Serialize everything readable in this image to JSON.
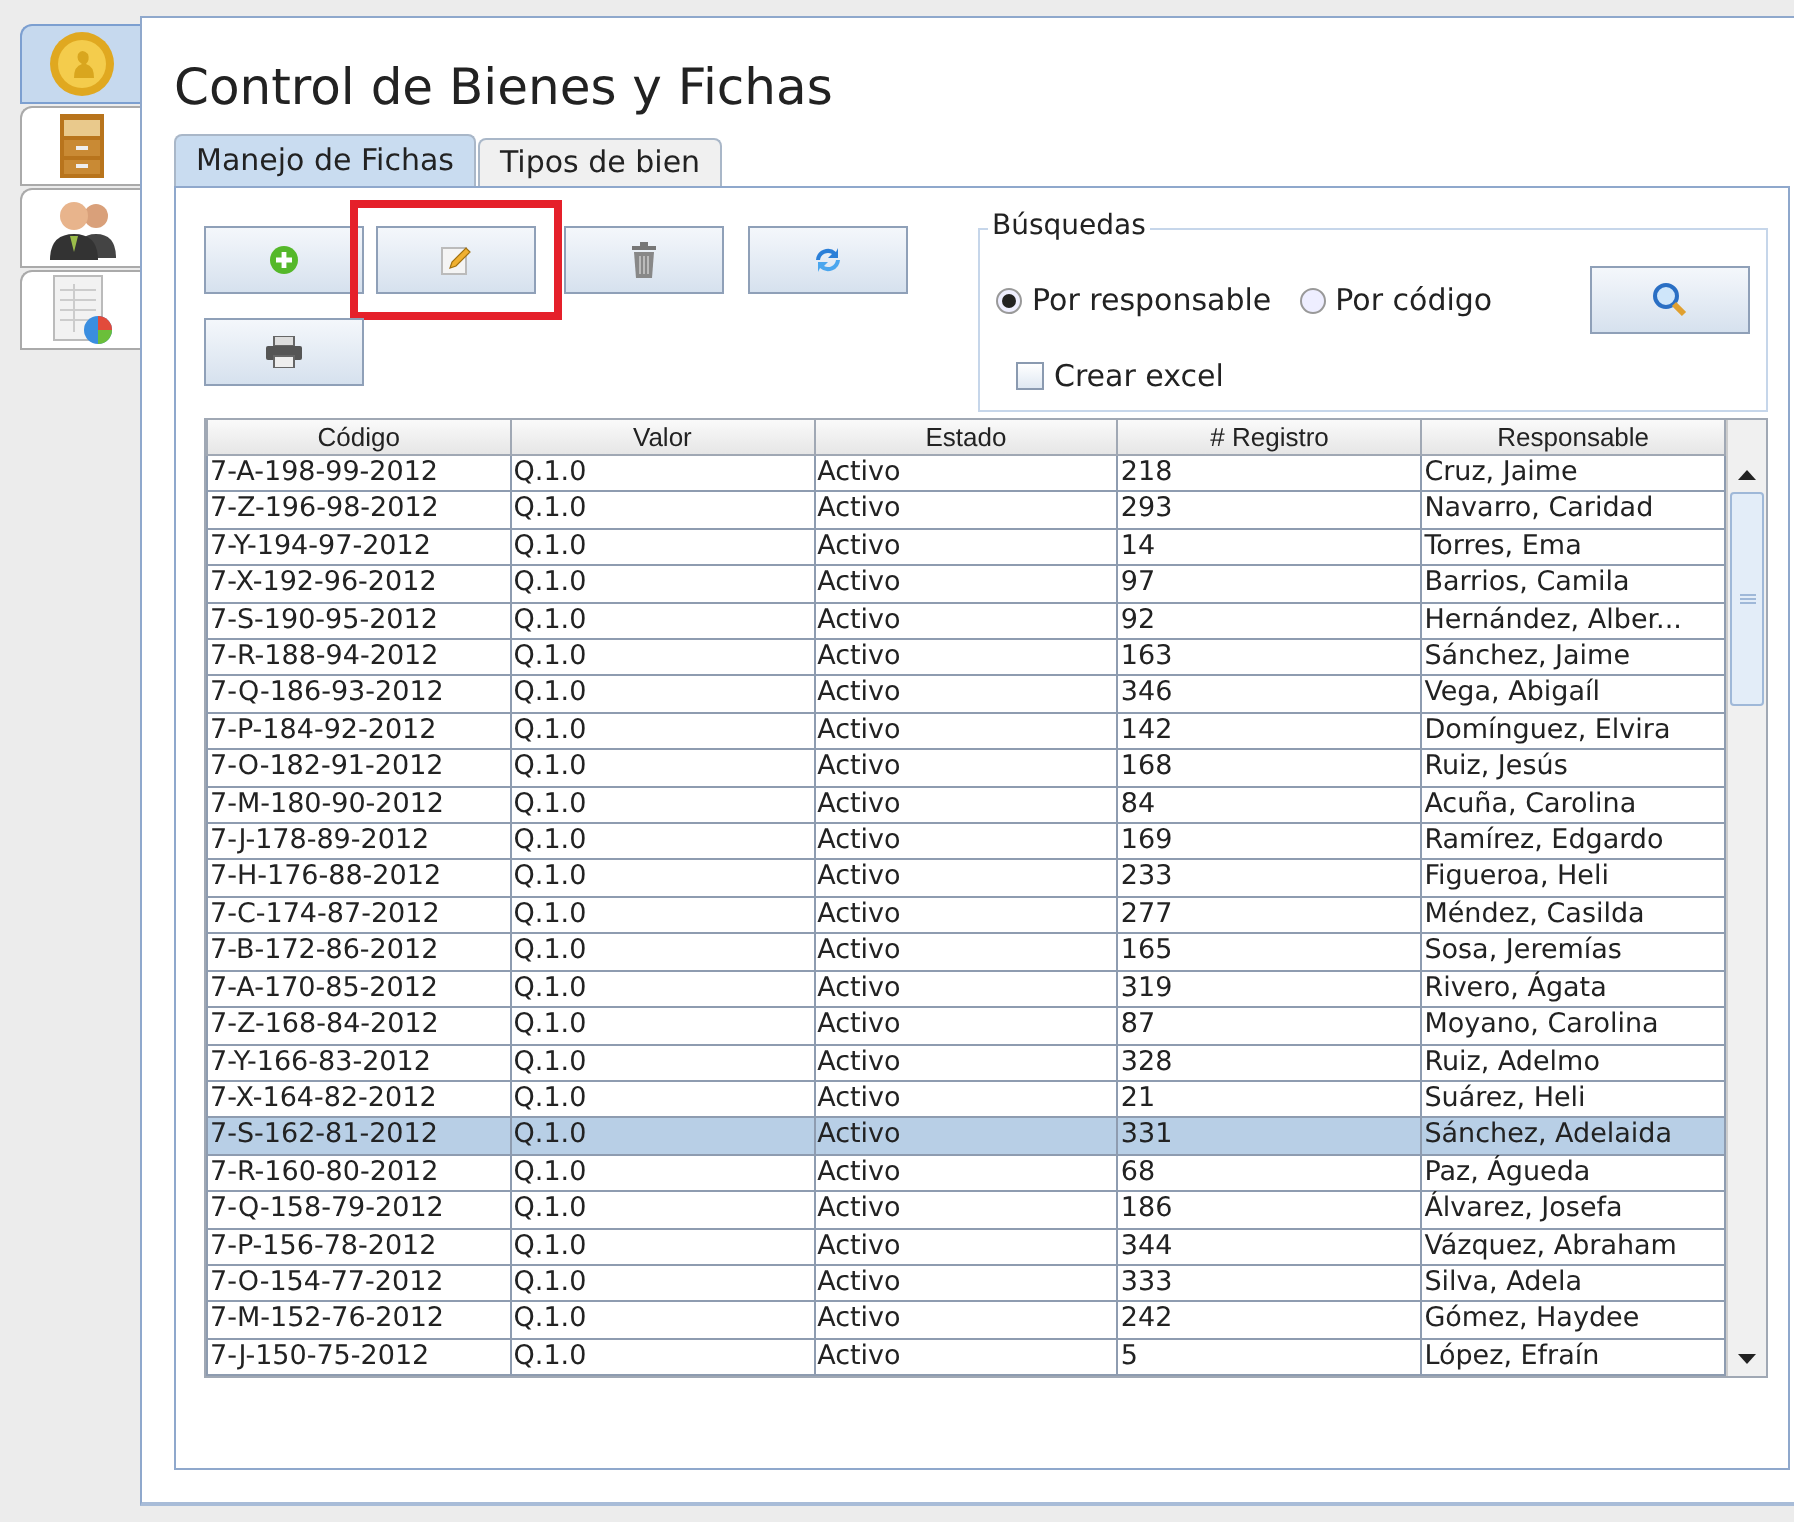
{
  "side_tabs": [
    {
      "kind": "coin",
      "selected": true
    },
    {
      "kind": "cabinet",
      "selected": false
    },
    {
      "kind": "people",
      "selected": false
    },
    {
      "kind": "report",
      "selected": false
    }
  ],
  "title": "Control de Bienes y Fichas",
  "tabs": [
    {
      "label": "Manejo de Fichas",
      "selected": true
    },
    {
      "label": "Tipos de bien",
      "selected": false
    }
  ],
  "toolbar": [
    {
      "kind": "add",
      "highlighted": false
    },
    {
      "kind": "edit",
      "highlighted": true
    },
    {
      "kind": "delete",
      "highlighted": false
    },
    {
      "kind": "refresh",
      "highlighted": false
    },
    {
      "kind": "print",
      "highlighted": false
    }
  ],
  "search": {
    "title": "Búsquedas",
    "options": [
      {
        "label": "Por responsable",
        "selected": true
      },
      {
        "label": "Por código",
        "selected": false
      }
    ],
    "excel": {
      "label": "Crear excel",
      "checked": false
    }
  },
  "table": {
    "columns": [
      "Código",
      "Valor",
      "Estado",
      "# Registro",
      "Responsable"
    ],
    "rows": [
      {
        "cells": [
          "7-A-198-99-2012",
          "Q.1.0",
          "Activo",
          "218",
          "Cruz, Jaime"
        ],
        "selected": false
      },
      {
        "cells": [
          "7-Z-196-98-2012",
          "Q.1.0",
          "Activo",
          "293",
          "Navarro, Caridad"
        ],
        "selected": false
      },
      {
        "cells": [
          "7-Y-194-97-2012",
          "Q.1.0",
          "Activo",
          "14",
          "Torres, Ema"
        ],
        "selected": false
      },
      {
        "cells": [
          "7-X-192-96-2012",
          "Q.1.0",
          "Activo",
          "97",
          "Barrios, Camila"
        ],
        "selected": false
      },
      {
        "cells": [
          "7-S-190-95-2012",
          "Q.1.0",
          "Activo",
          "92",
          "Hernández, Alber..."
        ],
        "selected": false
      },
      {
        "cells": [
          "7-R-188-94-2012",
          "Q.1.0",
          "Activo",
          "163",
          "Sánchez, Jaime"
        ],
        "selected": false
      },
      {
        "cells": [
          "7-Q-186-93-2012",
          "Q.1.0",
          "Activo",
          "346",
          "Vega, Abigaíl"
        ],
        "selected": false
      },
      {
        "cells": [
          "7-P-184-92-2012",
          "Q.1.0",
          "Activo",
          "142",
          "Domínguez, Elvira"
        ],
        "selected": false
      },
      {
        "cells": [
          "7-O-182-91-2012",
          "Q.1.0",
          "Activo",
          "168",
          "Ruiz, Jesús"
        ],
        "selected": false
      },
      {
        "cells": [
          "7-M-180-90-2012",
          "Q.1.0",
          "Activo",
          "84",
          "Acuña, Carolina"
        ],
        "selected": false
      },
      {
        "cells": [
          "7-J-178-89-2012",
          "Q.1.0",
          "Activo",
          "169",
          "Ramírez, Edgardo"
        ],
        "selected": false
      },
      {
        "cells": [
          "7-H-176-88-2012",
          "Q.1.0",
          "Activo",
          "233",
          "Figueroa, Heli"
        ],
        "selected": false
      },
      {
        "cells": [
          "7-C-174-87-2012",
          "Q.1.0",
          "Activo",
          "277",
          "Méndez, Casilda"
        ],
        "selected": false
      },
      {
        "cells": [
          "7-B-172-86-2012",
          "Q.1.0",
          "Activo",
          "165",
          "Sosa, Jeremías"
        ],
        "selected": false
      },
      {
        "cells": [
          "7-A-170-85-2012",
          "Q.1.0",
          "Activo",
          "319",
          "Rivero, Ágata"
        ],
        "selected": false
      },
      {
        "cells": [
          "7-Z-168-84-2012",
          "Q.1.0",
          "Activo",
          "87",
          "Moyano, Carolina"
        ],
        "selected": false
      },
      {
        "cells": [
          "7-Y-166-83-2012",
          "Q.1.0",
          "Activo",
          "328",
          "Ruiz, Adelmo"
        ],
        "selected": false
      },
      {
        "cells": [
          "7-X-164-82-2012",
          "Q.1.0",
          "Activo",
          "21",
          "Suárez, Heli"
        ],
        "selected": false
      },
      {
        "cells": [
          "7-S-162-81-2012",
          "Q.1.0",
          "Activo",
          "331",
          "Sánchez, Adelaida"
        ],
        "selected": true
      },
      {
        "cells": [
          "7-R-160-80-2012",
          "Q.1.0",
          "Activo",
          "68",
          "Paz, Águeda"
        ],
        "selected": false
      },
      {
        "cells": [
          "7-Q-158-79-2012",
          "Q.1.0",
          "Activo",
          "186",
          "Álvarez, Josefa"
        ],
        "selected": false
      },
      {
        "cells": [
          "7-P-156-78-2012",
          "Q.1.0",
          "Activo",
          "344",
          "Vázquez, Abraham"
        ],
        "selected": false
      },
      {
        "cells": [
          "7-O-154-77-2012",
          "Q.1.0",
          "Activo",
          "333",
          "Silva, Adela"
        ],
        "selected": false
      },
      {
        "cells": [
          "7-M-152-76-2012",
          "Q.1.0",
          "Activo",
          "242",
          "Gómez, Haydee"
        ],
        "selected": false
      },
      {
        "cells": [
          "7-J-150-75-2012",
          "Q.1.0",
          "Activo",
          "5",
          "López, Efraín"
        ],
        "selected": false
      }
    ]
  }
}
